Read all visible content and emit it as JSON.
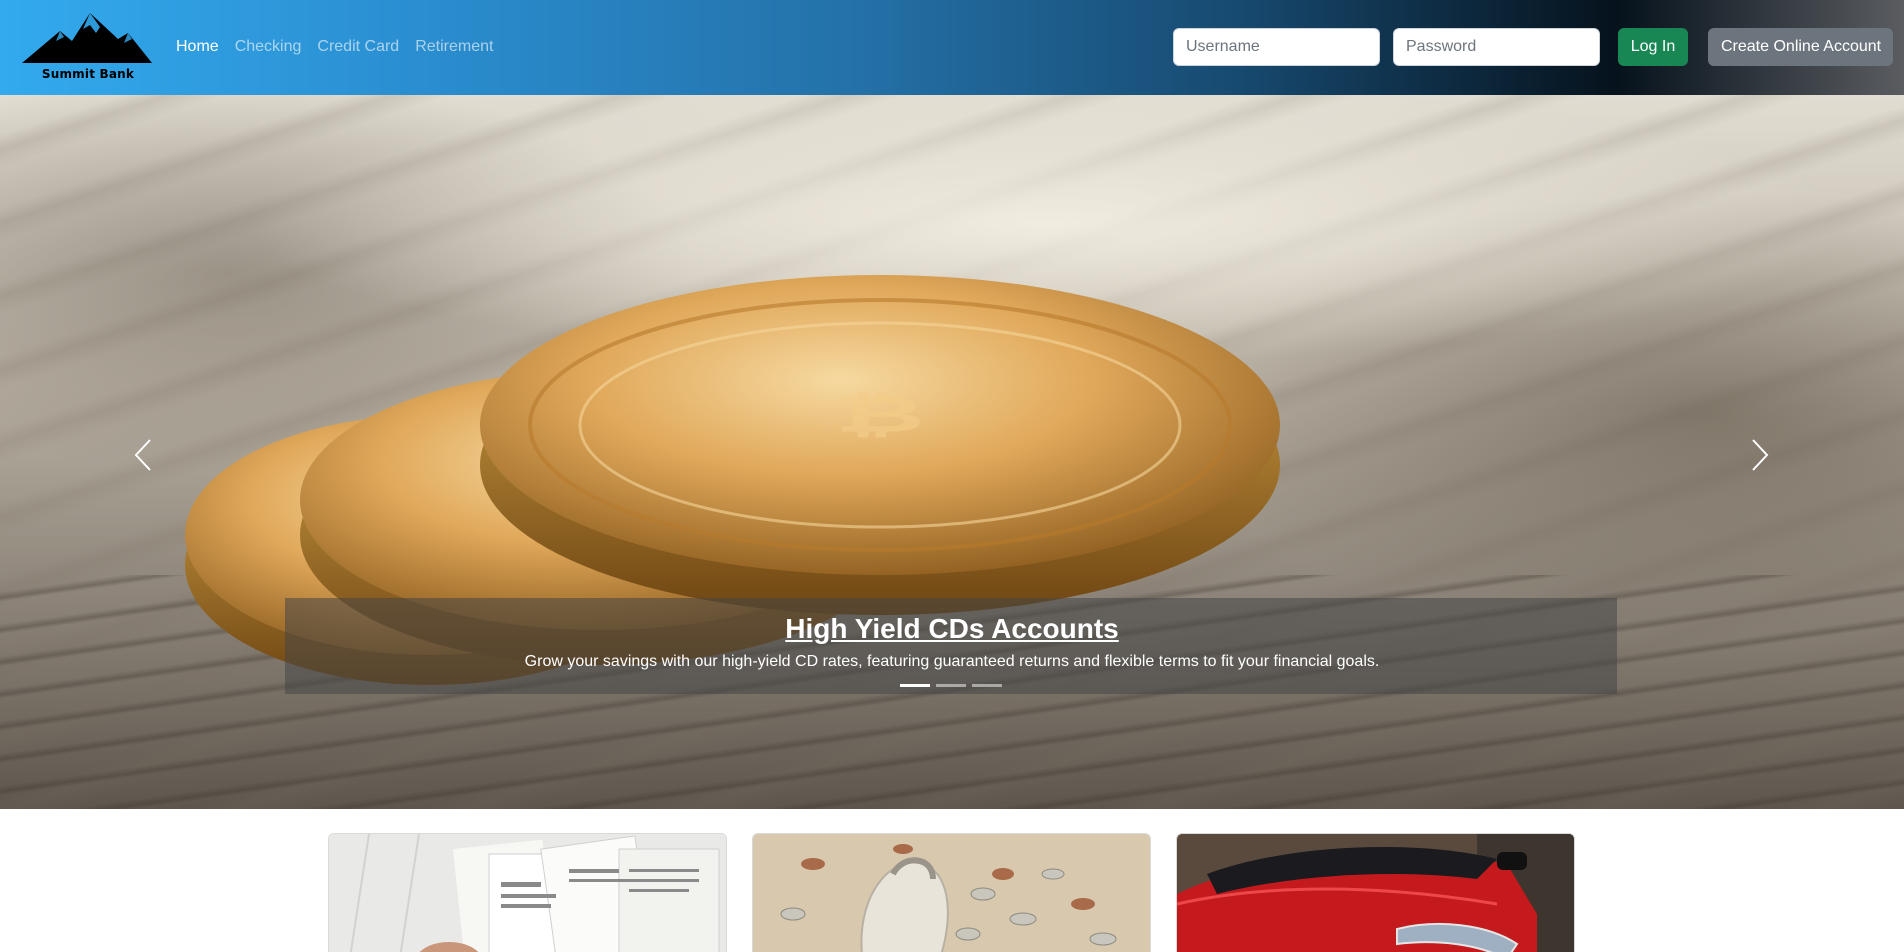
{
  "brand": {
    "name": "Summit Bank",
    "icon": "mountain-logo-icon"
  },
  "nav": {
    "items": [
      {
        "label": "Home",
        "active": true
      },
      {
        "label": "Checking",
        "active": false
      },
      {
        "label": "Credit Card",
        "active": false
      },
      {
        "label": "Retirement",
        "active": false
      }
    ]
  },
  "login": {
    "username_placeholder": "Username",
    "username_value": "",
    "password_placeholder": "Password",
    "password_value": "",
    "login_label": "Log In",
    "create_label": "Create Online Account"
  },
  "carousel": {
    "title": "High Yield CDs Accounts",
    "text": "Grow your savings with our high-yield CD rates, featuring guaranteed returns and flexible terms to fit your financial goals.",
    "slide_count": 3,
    "active_index": 0,
    "prev_icon": "chevron-left-icon",
    "next_icon": "chevron-right-icon",
    "image_subject": "gold coins on dollar bills"
  },
  "cards": [
    {
      "image_subject": "tax forms paperwork"
    },
    {
      "image_subject": "piggy bank with coins"
    },
    {
      "image_subject": "red car"
    }
  ],
  "colors": {
    "nav_gradient_start": "#33aaee",
    "nav_gradient_end": "#06121c",
    "login_button": "#198754",
    "create_button": "#6c757d"
  }
}
